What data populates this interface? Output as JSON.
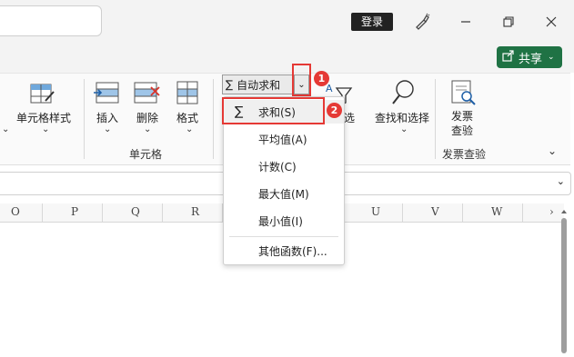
{
  "titlebar": {
    "login_label": "登录",
    "icons": [
      "pen-brush-icon",
      "minimize-icon",
      "restore-icon",
      "close-icon"
    ]
  },
  "share": {
    "label": "共享",
    "icon": "share-icon"
  },
  "ribbon": {
    "cell_style_label": "单元格样式",
    "insert_label": "插入",
    "delete_label": "删除",
    "format_label": "格式",
    "cells_group_label": "单元格",
    "autosum_label": "自动求和",
    "autosum_symbol": "∑",
    "filter_label": "筛选",
    "find_select_label": "查找和选择",
    "invoice_check_line1": "发票",
    "invoice_check_line2": "查验",
    "invoice_group_label": "发票查验"
  },
  "callouts": {
    "one": "1",
    "two": "2"
  },
  "menu": {
    "sum_symbol": "∑",
    "items": [
      "求和(S)",
      "平均值(A)",
      "计数(C)",
      "最大值(M)",
      "最小值(I)",
      "其他函数(F)..."
    ]
  },
  "columns": [
    "O",
    "P",
    "Q",
    "R",
    "U",
    "V",
    "W"
  ],
  "accent_colors": {
    "share_green": "#1f7244",
    "callout_red": "#e53935"
  }
}
